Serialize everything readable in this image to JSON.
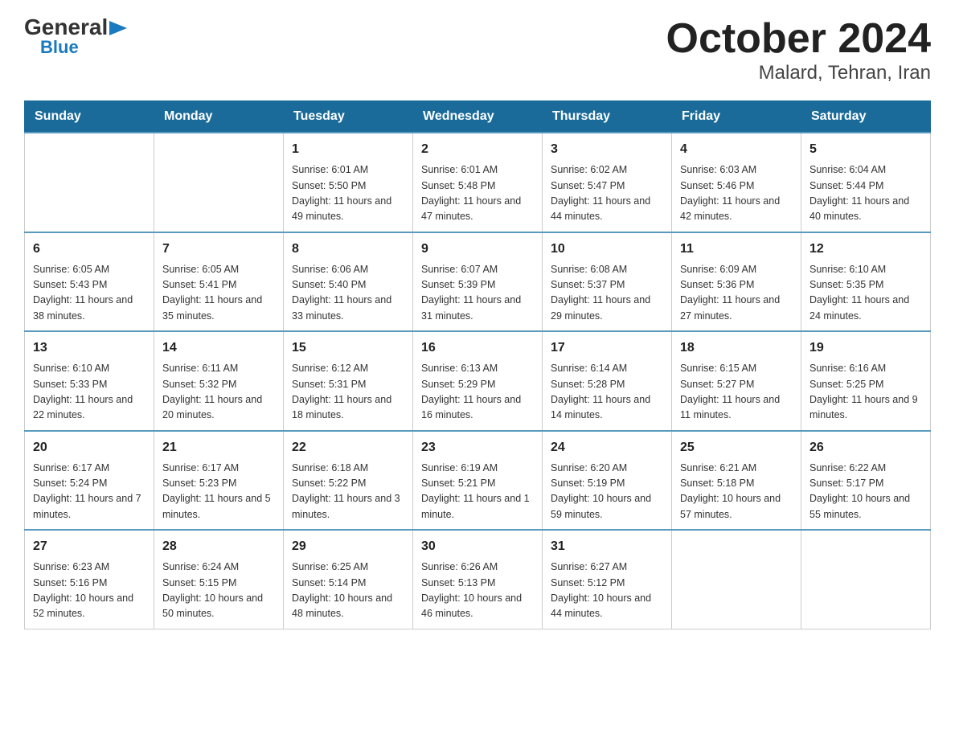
{
  "logo": {
    "general": "General",
    "blue": "Blue",
    "arrow": "▶"
  },
  "title": {
    "month": "October 2024",
    "location": "Malard, Tehran, Iran"
  },
  "weekdays": [
    "Sunday",
    "Monday",
    "Tuesday",
    "Wednesday",
    "Thursday",
    "Friday",
    "Saturday"
  ],
  "weeks": [
    [
      {
        "day": "",
        "info": ""
      },
      {
        "day": "",
        "info": ""
      },
      {
        "day": "1",
        "info": "Sunrise: 6:01 AM\nSunset: 5:50 PM\nDaylight: 11 hours\nand 49 minutes."
      },
      {
        "day": "2",
        "info": "Sunrise: 6:01 AM\nSunset: 5:48 PM\nDaylight: 11 hours\nand 47 minutes."
      },
      {
        "day": "3",
        "info": "Sunrise: 6:02 AM\nSunset: 5:47 PM\nDaylight: 11 hours\nand 44 minutes."
      },
      {
        "day": "4",
        "info": "Sunrise: 6:03 AM\nSunset: 5:46 PM\nDaylight: 11 hours\nand 42 minutes."
      },
      {
        "day": "5",
        "info": "Sunrise: 6:04 AM\nSunset: 5:44 PM\nDaylight: 11 hours\nand 40 minutes."
      }
    ],
    [
      {
        "day": "6",
        "info": "Sunrise: 6:05 AM\nSunset: 5:43 PM\nDaylight: 11 hours\nand 38 minutes."
      },
      {
        "day": "7",
        "info": "Sunrise: 6:05 AM\nSunset: 5:41 PM\nDaylight: 11 hours\nand 35 minutes."
      },
      {
        "day": "8",
        "info": "Sunrise: 6:06 AM\nSunset: 5:40 PM\nDaylight: 11 hours\nand 33 minutes."
      },
      {
        "day": "9",
        "info": "Sunrise: 6:07 AM\nSunset: 5:39 PM\nDaylight: 11 hours\nand 31 minutes."
      },
      {
        "day": "10",
        "info": "Sunrise: 6:08 AM\nSunset: 5:37 PM\nDaylight: 11 hours\nand 29 minutes."
      },
      {
        "day": "11",
        "info": "Sunrise: 6:09 AM\nSunset: 5:36 PM\nDaylight: 11 hours\nand 27 minutes."
      },
      {
        "day": "12",
        "info": "Sunrise: 6:10 AM\nSunset: 5:35 PM\nDaylight: 11 hours\nand 24 minutes."
      }
    ],
    [
      {
        "day": "13",
        "info": "Sunrise: 6:10 AM\nSunset: 5:33 PM\nDaylight: 11 hours\nand 22 minutes."
      },
      {
        "day": "14",
        "info": "Sunrise: 6:11 AM\nSunset: 5:32 PM\nDaylight: 11 hours\nand 20 minutes."
      },
      {
        "day": "15",
        "info": "Sunrise: 6:12 AM\nSunset: 5:31 PM\nDaylight: 11 hours\nand 18 minutes."
      },
      {
        "day": "16",
        "info": "Sunrise: 6:13 AM\nSunset: 5:29 PM\nDaylight: 11 hours\nand 16 minutes."
      },
      {
        "day": "17",
        "info": "Sunrise: 6:14 AM\nSunset: 5:28 PM\nDaylight: 11 hours\nand 14 minutes."
      },
      {
        "day": "18",
        "info": "Sunrise: 6:15 AM\nSunset: 5:27 PM\nDaylight: 11 hours\nand 11 minutes."
      },
      {
        "day": "19",
        "info": "Sunrise: 6:16 AM\nSunset: 5:25 PM\nDaylight: 11 hours\nand 9 minutes."
      }
    ],
    [
      {
        "day": "20",
        "info": "Sunrise: 6:17 AM\nSunset: 5:24 PM\nDaylight: 11 hours\nand 7 minutes."
      },
      {
        "day": "21",
        "info": "Sunrise: 6:17 AM\nSunset: 5:23 PM\nDaylight: 11 hours\nand 5 minutes."
      },
      {
        "day": "22",
        "info": "Sunrise: 6:18 AM\nSunset: 5:22 PM\nDaylight: 11 hours\nand 3 minutes."
      },
      {
        "day": "23",
        "info": "Sunrise: 6:19 AM\nSunset: 5:21 PM\nDaylight: 11 hours\nand 1 minute."
      },
      {
        "day": "24",
        "info": "Sunrise: 6:20 AM\nSunset: 5:19 PM\nDaylight: 10 hours\nand 59 minutes."
      },
      {
        "day": "25",
        "info": "Sunrise: 6:21 AM\nSunset: 5:18 PM\nDaylight: 10 hours\nand 57 minutes."
      },
      {
        "day": "26",
        "info": "Sunrise: 6:22 AM\nSunset: 5:17 PM\nDaylight: 10 hours\nand 55 minutes."
      }
    ],
    [
      {
        "day": "27",
        "info": "Sunrise: 6:23 AM\nSunset: 5:16 PM\nDaylight: 10 hours\nand 52 minutes."
      },
      {
        "day": "28",
        "info": "Sunrise: 6:24 AM\nSunset: 5:15 PM\nDaylight: 10 hours\nand 50 minutes."
      },
      {
        "day": "29",
        "info": "Sunrise: 6:25 AM\nSunset: 5:14 PM\nDaylight: 10 hours\nand 48 minutes."
      },
      {
        "day": "30",
        "info": "Sunrise: 6:26 AM\nSunset: 5:13 PM\nDaylight: 10 hours\nand 46 minutes."
      },
      {
        "day": "31",
        "info": "Sunrise: 6:27 AM\nSunset: 5:12 PM\nDaylight: 10 hours\nand 44 minutes."
      },
      {
        "day": "",
        "info": ""
      },
      {
        "day": "",
        "info": ""
      }
    ]
  ]
}
